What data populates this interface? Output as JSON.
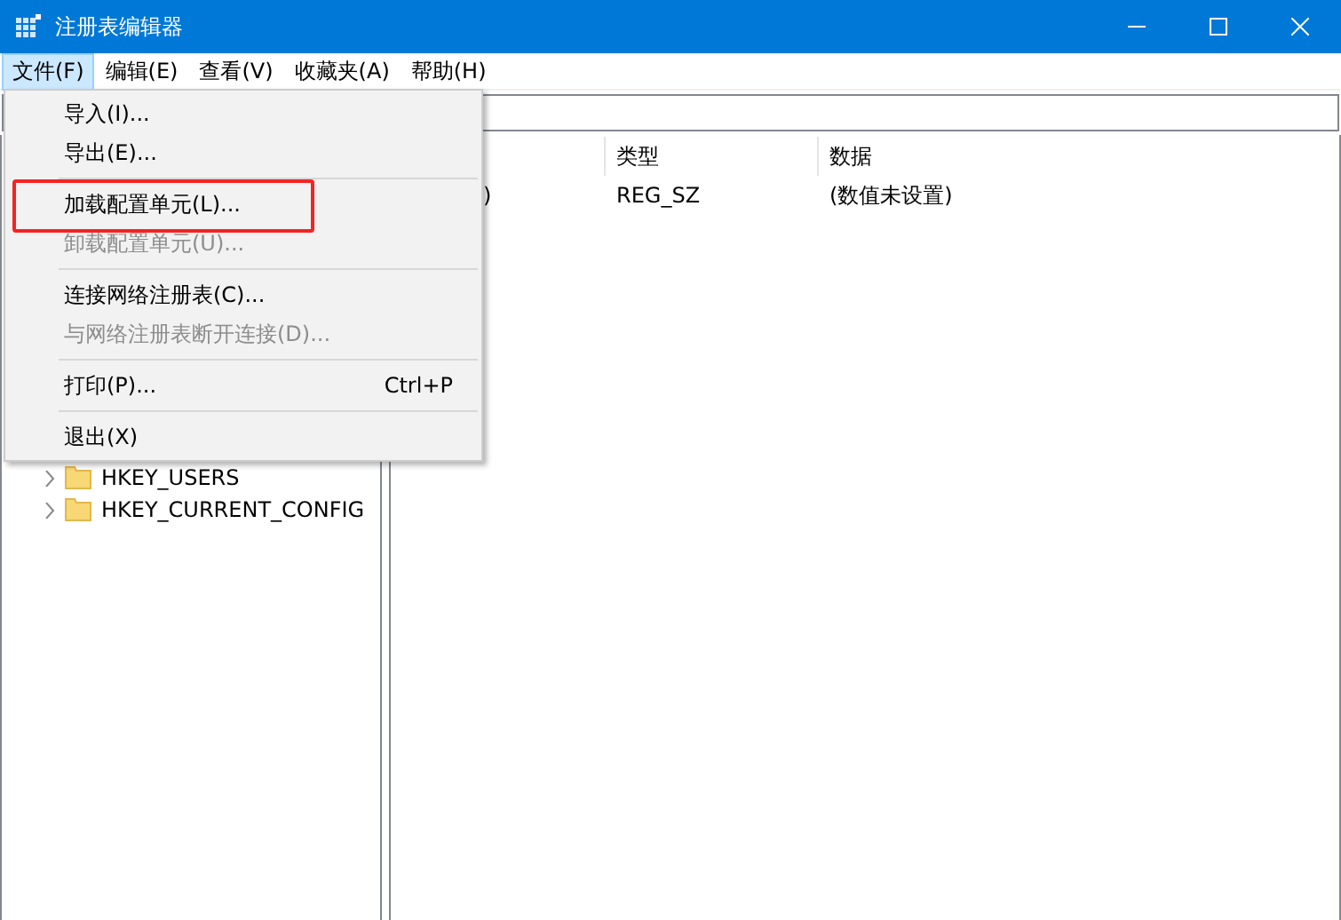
{
  "window": {
    "title": "注册表编辑器"
  },
  "menubar": [
    {
      "label": "文件(F)",
      "selected": true
    },
    {
      "label": "编辑(E)",
      "selected": false
    },
    {
      "label": "查看(V)",
      "selected": false
    },
    {
      "label": "收藏夹(A)",
      "selected": false
    },
    {
      "label": "帮助(H)",
      "selected": false
    }
  ],
  "file_menu": [
    {
      "kind": "item",
      "label": "导入(I)...",
      "disabled": false,
      "highlighted": false
    },
    {
      "kind": "item",
      "label": "导出(E)...",
      "disabled": false,
      "highlighted": false
    },
    {
      "kind": "separator"
    },
    {
      "kind": "item",
      "label": "加载配置单元(L)...",
      "disabled": false,
      "highlighted": true
    },
    {
      "kind": "item",
      "label": "卸载配置单元(U)...",
      "disabled": true,
      "highlighted": false
    },
    {
      "kind": "separator"
    },
    {
      "kind": "item",
      "label": "连接网络注册表(C)...",
      "disabled": false,
      "highlighted": false
    },
    {
      "kind": "item",
      "label": "与网络注册表断开连接(D)...",
      "disabled": true,
      "highlighted": false
    },
    {
      "kind": "separator"
    },
    {
      "kind": "item",
      "label": "打印(P)...",
      "shortcut": "Ctrl+P",
      "disabled": false,
      "highlighted": false
    },
    {
      "kind": "separator"
    },
    {
      "kind": "item",
      "label": "退出(X)",
      "disabled": false,
      "highlighted": false
    }
  ],
  "tree": [
    {
      "label": "HKEY_USERS",
      "expanded": false
    },
    {
      "label": "HKEY_CURRENT_CONFIG",
      "expanded": false
    }
  ],
  "table": {
    "columns": [
      "类型",
      "数据"
    ],
    "rows": [
      {
        "name": ")",
        "type": "REG_SZ",
        "data": "(数值未设置)"
      }
    ]
  }
}
